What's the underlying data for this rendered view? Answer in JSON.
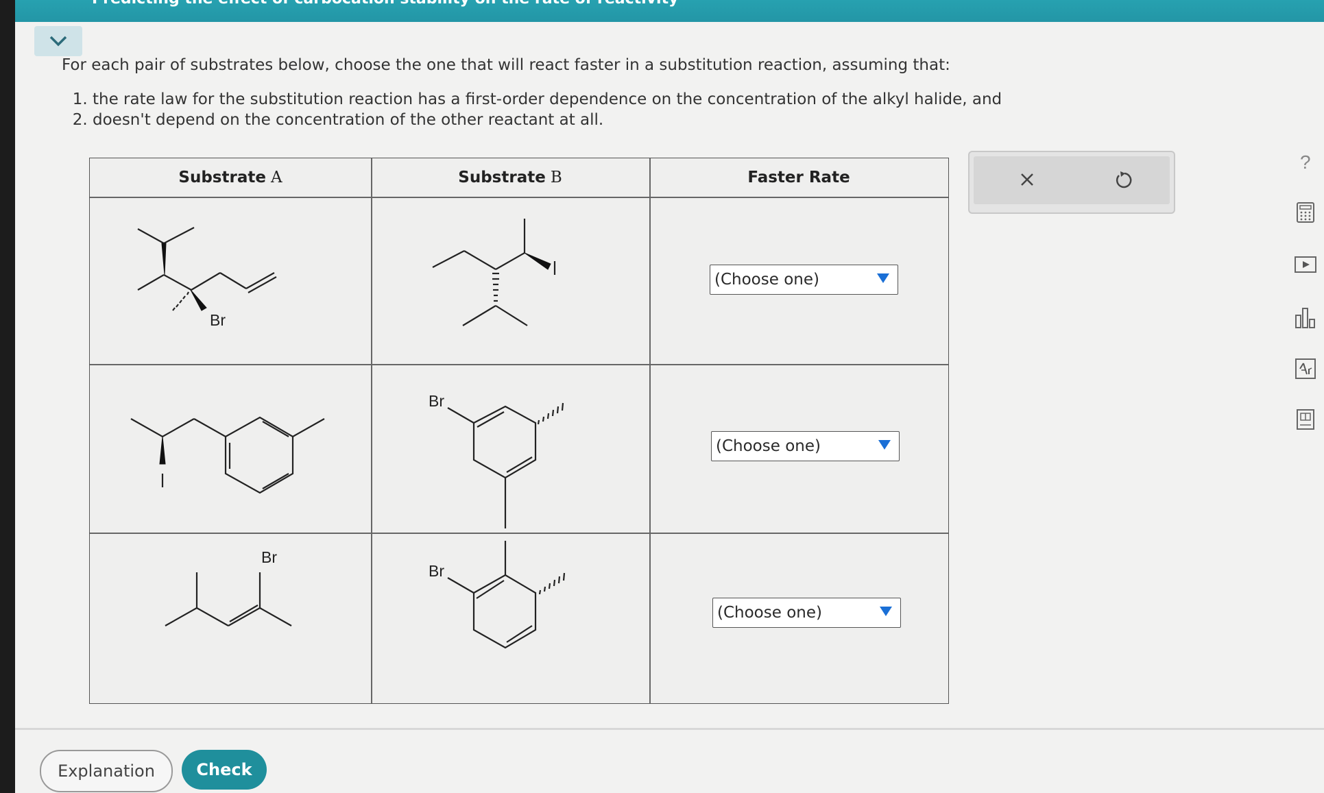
{
  "header": {
    "title": "Predicting the effect of carbocation stability on the rate of reactivity"
  },
  "instructions": {
    "intro": "For each pair of substrates below, choose the one that will react faster in a substitution reaction, assuming that:",
    "items": [
      "the rate law for the substitution reaction has a first-order dependence on the concentration of the alkyl halide, and",
      "doesn't depend on the concentration of the other reactant at all."
    ]
  },
  "table": {
    "headers": {
      "substrate_a": "Substrate",
      "substrate_a_var": "A",
      "substrate_b": "Substrate",
      "substrate_b_var": "B",
      "faster": "Faster Rate"
    },
    "rows": [
      {
        "a_label": "Br",
        "b_label": "I",
        "choice": "(Choose one)"
      },
      {
        "a_label": "I",
        "b_label": "Br",
        "choice": "(Choose one)"
      },
      {
        "a_label": "Br",
        "b_label": "Br",
        "choice": "(Choose one)"
      }
    ]
  },
  "actions": {
    "close_icon": "close-icon",
    "undo_icon": "undo-icon"
  },
  "sidebar": [
    "help-icon",
    "calculator-icon",
    "video-icon",
    "chart-icon",
    "periodic-table-icon",
    "book-icon"
  ],
  "sidebar_help_glyph": "?",
  "footer": {
    "explanation": "Explanation",
    "check": "Check"
  }
}
